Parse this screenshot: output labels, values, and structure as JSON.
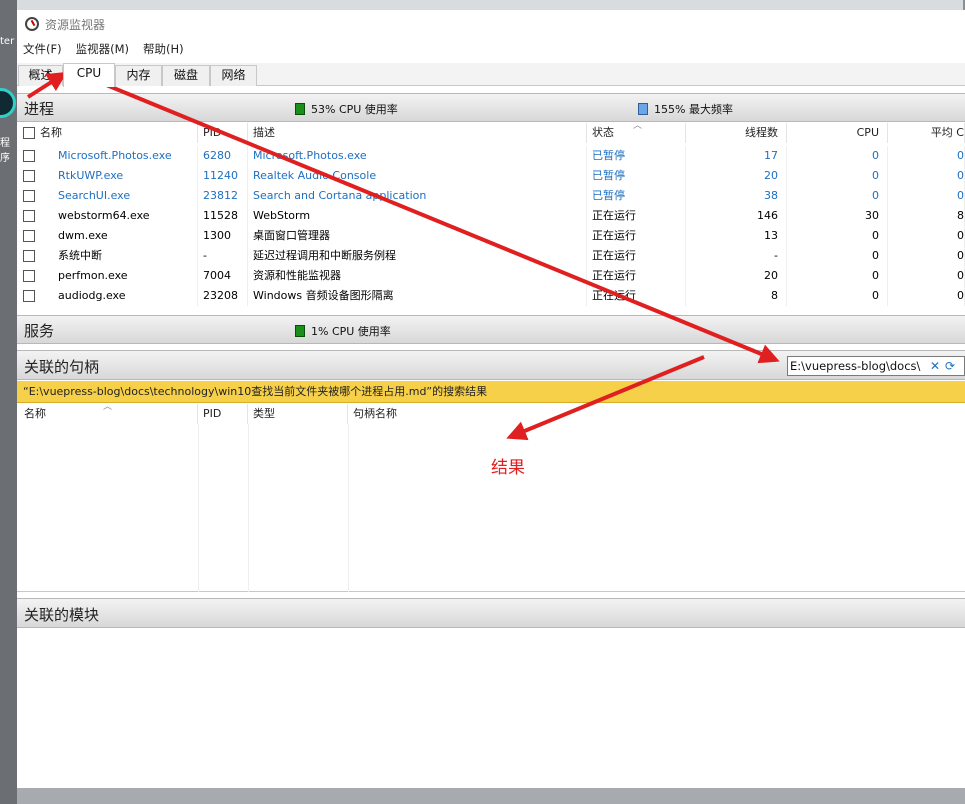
{
  "window": {
    "title": "资源监视器"
  },
  "menu": {
    "items": [
      "文件(F)",
      "监视器(M)",
      "帮助(H)"
    ]
  },
  "tabs": [
    "概述",
    "CPU",
    "内存",
    "磁盘",
    "网络"
  ],
  "processes": {
    "title": "进程",
    "cpu_usage": "53% CPU 使用率",
    "max_freq": "155% 最大频率",
    "columns": [
      "名称",
      "PID",
      "描述",
      "状态",
      "线程数",
      "CPU",
      "平均 C"
    ],
    "rows": [
      {
        "name": "Microsoft.Photos.exe",
        "pid": "6280",
        "desc": "Microsoft.Photos.exe",
        "status": "已暂停",
        "threads": "17",
        "cpu": "0",
        "avg": "0",
        "suspended": true
      },
      {
        "name": "RtkUWP.exe",
        "pid": "11240",
        "desc": "Realtek Audio Console",
        "status": "已暂停",
        "threads": "20",
        "cpu": "0",
        "avg": "0",
        "suspended": true
      },
      {
        "name": "SearchUI.exe",
        "pid": "23812",
        "desc": "Search and Cortana application",
        "status": "已暂停",
        "threads": "38",
        "cpu": "0",
        "avg": "0",
        "suspended": true
      },
      {
        "name": "webstorm64.exe",
        "pid": "11528",
        "desc": "WebStorm",
        "status": "正在运行",
        "threads": "146",
        "cpu": "30",
        "avg": "8",
        "suspended": false
      },
      {
        "name": "dwm.exe",
        "pid": "1300",
        "desc": "桌面窗口管理器",
        "status": "正在运行",
        "threads": "13",
        "cpu": "0",
        "avg": "0",
        "suspended": false
      },
      {
        "name": "系统中断",
        "pid": "-",
        "desc": "延迟过程调用和中断服务例程",
        "status": "正在运行",
        "threads": "-",
        "cpu": "0",
        "avg": "0",
        "suspended": false
      },
      {
        "name": "perfmon.exe",
        "pid": "7004",
        "desc": "资源和性能监视器",
        "status": "正在运行",
        "threads": "20",
        "cpu": "0",
        "avg": "0",
        "suspended": false
      },
      {
        "name": "audiodg.exe",
        "pid": "23208",
        "desc": "Windows 音频设备图形隔离",
        "status": "正在运行",
        "threads": "8",
        "cpu": "0",
        "avg": "0",
        "suspended": false
      }
    ]
  },
  "services": {
    "title": "服务",
    "cpu_usage": "1% CPU 使用率"
  },
  "handles": {
    "title": "关联的句柄",
    "search_value": "E:\\vuepress-blog\\docs\\",
    "banner": "“E:\\vuepress-blog\\docs\\technology\\win10查找当前文件夹被哪个进程占用.md”的搜索结果",
    "columns": [
      "名称",
      "PID",
      "类型",
      "句柄名称"
    ]
  },
  "modules": {
    "title": "关联的模块"
  },
  "annotation": {
    "label": "结果",
    "color": "#e02020"
  },
  "colors": {
    "suspended_text": "#1d6fc2",
    "banner_bg": "#f7d04a",
    "cpu_graph": "#1a8f1a",
    "freq_graph": "#6aa6e8"
  }
}
